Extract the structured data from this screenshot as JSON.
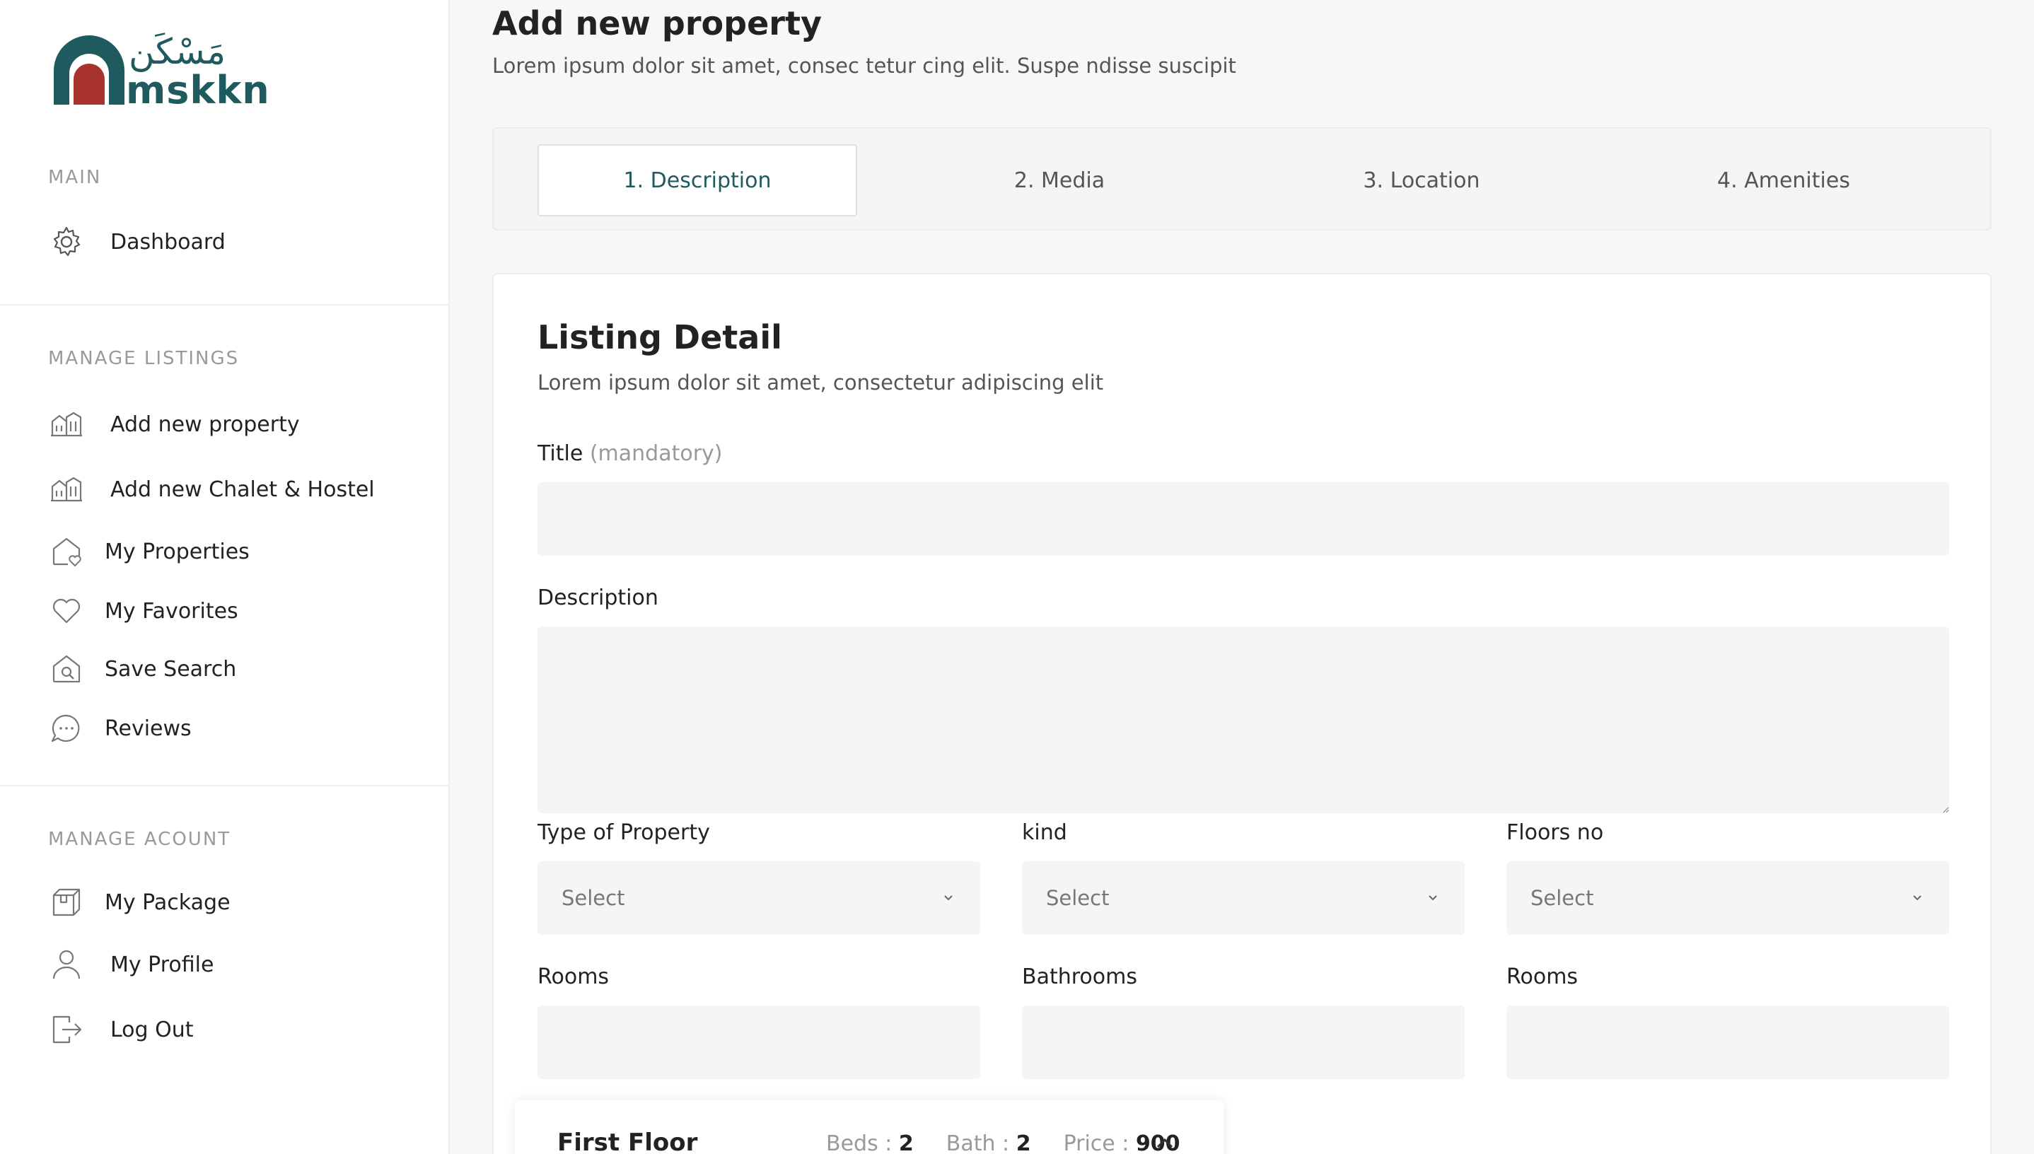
{
  "brand": {
    "name_latin": "mskkn",
    "name_arabic": "مَسْكَن",
    "colors": {
      "primary": "#1f5a5e",
      "accent": "#a8322d"
    }
  },
  "sidebar": {
    "sections": [
      {
        "label": "MAIN",
        "items": [
          {
            "label": "Dashboard",
            "icon": "gear-icon"
          }
        ]
      },
      {
        "label": "MANAGE LISTINGS",
        "items": [
          {
            "label": "Add new property",
            "icon": "building-icon"
          },
          {
            "label": "Add new Chalet & Hostel",
            "icon": "building-icon"
          },
          {
            "label": "My Properties",
            "icon": "home-heart-icon"
          },
          {
            "label": "My Favorites",
            "icon": "heart-icon"
          },
          {
            "label": "Save Search",
            "icon": "home-search-icon"
          },
          {
            "label": "Reviews",
            "icon": "chat-icon"
          }
        ]
      },
      {
        "label": "MANAGE ACOUNT",
        "items": [
          {
            "label": "My Package",
            "icon": "package-icon"
          },
          {
            "label": "My Profile",
            "icon": "user-icon"
          },
          {
            "label": "Log Out",
            "icon": "logout-icon"
          }
        ]
      }
    ]
  },
  "header": {
    "title": "Add new property",
    "subtitle": "Lorem ipsum dolor sit amet, consec tetur cing elit. Suspe ndisse suscipit"
  },
  "tabs": [
    {
      "label": "1. Description",
      "active": true
    },
    {
      "label": "2. Media",
      "active": false
    },
    {
      "label": "3. Location",
      "active": false
    },
    {
      "label": "4. Amenities",
      "active": false
    }
  ],
  "form": {
    "title": "Listing Detail",
    "subtitle": "Lorem ipsum dolor sit amet, consectetur adipiscing elit",
    "title_field": {
      "label": "Title",
      "hint": "(mandatory)",
      "value": ""
    },
    "description_field": {
      "label": "Description",
      "value": ""
    },
    "type_of_property": {
      "label": "Type of Property",
      "value": "Select"
    },
    "kind": {
      "label": "kind",
      "value": "Select"
    },
    "floors_no": {
      "label": "Floors no",
      "value": "Select"
    },
    "rooms": {
      "label": "Rooms",
      "value": ""
    },
    "bathrooms": {
      "label": "Bathrooms",
      "value": ""
    },
    "rooms_2": {
      "label": "Rooms",
      "value": ""
    }
  },
  "floor_panel": {
    "title": "First Floor",
    "beds_label": "Beds : ",
    "beds": "2",
    "bath_label": "Bath : ",
    "bath": "2",
    "price_label": "Price : ",
    "price": "900"
  }
}
